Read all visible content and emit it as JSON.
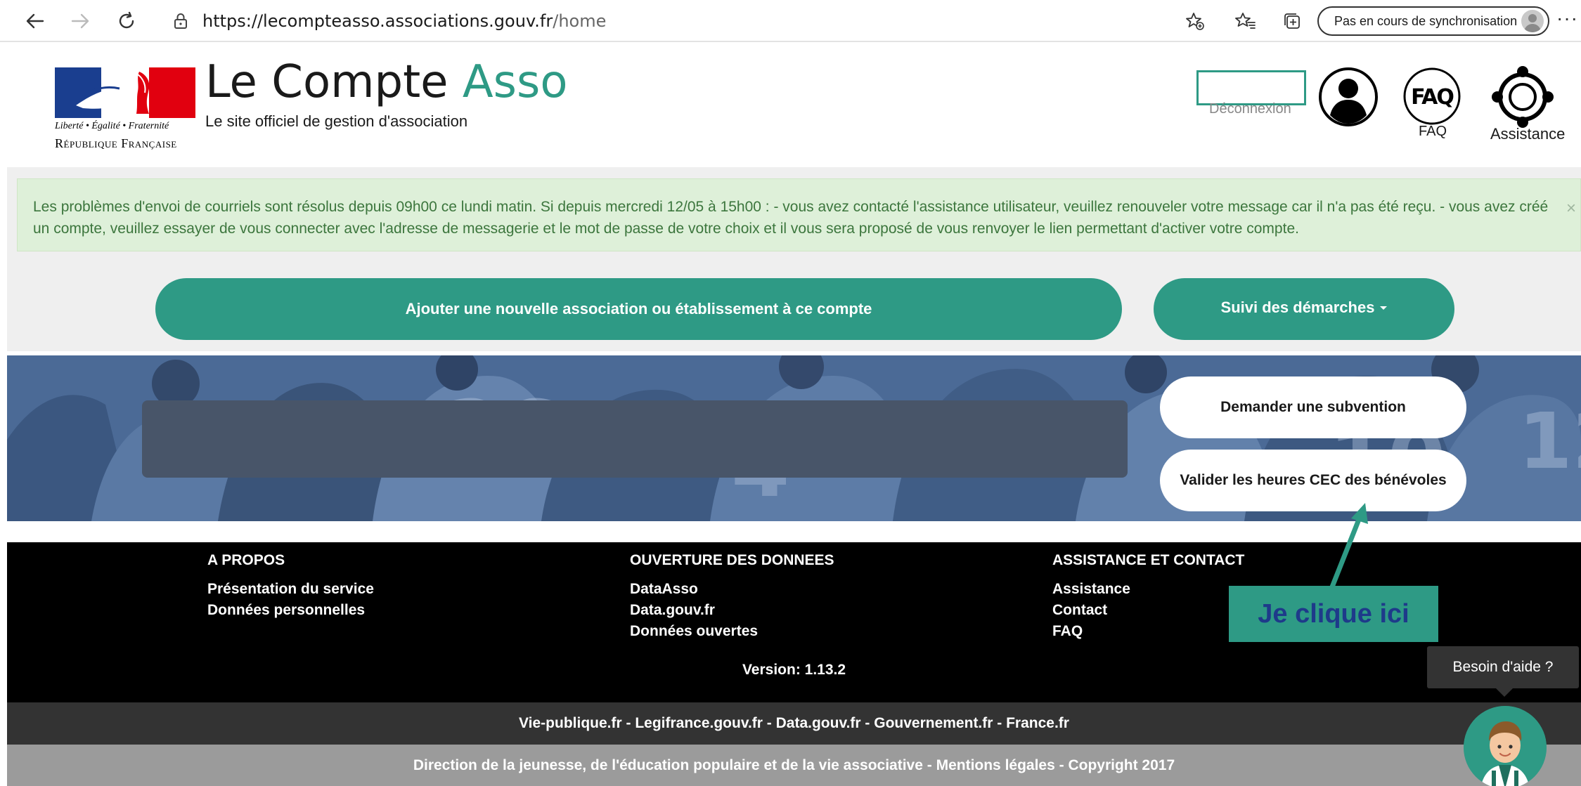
{
  "browser": {
    "url_host": "https://lecompteasso.associations.gouv.fr",
    "url_path": "/home",
    "sync_label": "Pas en cours de synchronisation",
    "more_label": "···"
  },
  "header": {
    "logo_devise": "Liberté • Égalité • Fraternité",
    "logo_republique": "République Française",
    "title_main": "Le Compte",
    "title_accent": "Asso",
    "subtitle": "Le site officiel de gestion d'association",
    "deconnexion_label": "Déconnexion",
    "faq_label": "FAQ",
    "assistance_label": "Assistance"
  },
  "alert": {
    "text": "Les problèmes d'envoi de courriels sont résolus depuis 09h00 ce lundi matin. Si depuis mercredi 12/05 à 15h00 : - vous avez contacté l'assistance utilisateur, veuillez renouveler votre message car il n'a pas été reçu. - vous avez créé un compte, veuillez essayer de vous connecter avec l'adresse de messagerie et le mot de passe de votre choix et il vous sera proposé de vous renvoyer le lien permettant d'activer votre compte.",
    "close": "×"
  },
  "actions": {
    "add_label": "Ajouter une nouvelle association ou établissement à ce compte",
    "suivi_label": "Suivi des démarches"
  },
  "banner": {
    "subvention_label": "Demander une subvention",
    "cec_label": "Valider les heures CEC des bénévoles"
  },
  "footer": {
    "columns": [
      {
        "title": "A PROPOS",
        "links": [
          "Présentation du service",
          "Données personnelles"
        ]
      },
      {
        "title": "OUVERTURE DES DONNEES",
        "links": [
          "DataAsso",
          "Data.gouv.fr",
          "Données ouvertes"
        ]
      },
      {
        "title": "ASSISTANCE ET CONTACT",
        "links": [
          "Assistance",
          "Contact",
          "FAQ"
        ]
      }
    ],
    "version": "Version: 1.13.2",
    "gov_links": "Vie-publique.fr - Legifrance.gouv.fr - Data.gouv.fr - Gouvernement.fr - France.fr",
    "legal": "Direction de la jeunesse, de l'éducation populaire et de la vie associative - Mentions légales - Copyright 2017"
  },
  "annotation": {
    "label": "Je clique ici"
  },
  "help": {
    "tooltip": "Besoin d'aide ?"
  },
  "colors": {
    "brand_green": "#2e9a85",
    "alert_bg": "#def0d9",
    "alert_text": "#3c763d",
    "annotation_text": "#1e3a8a"
  }
}
